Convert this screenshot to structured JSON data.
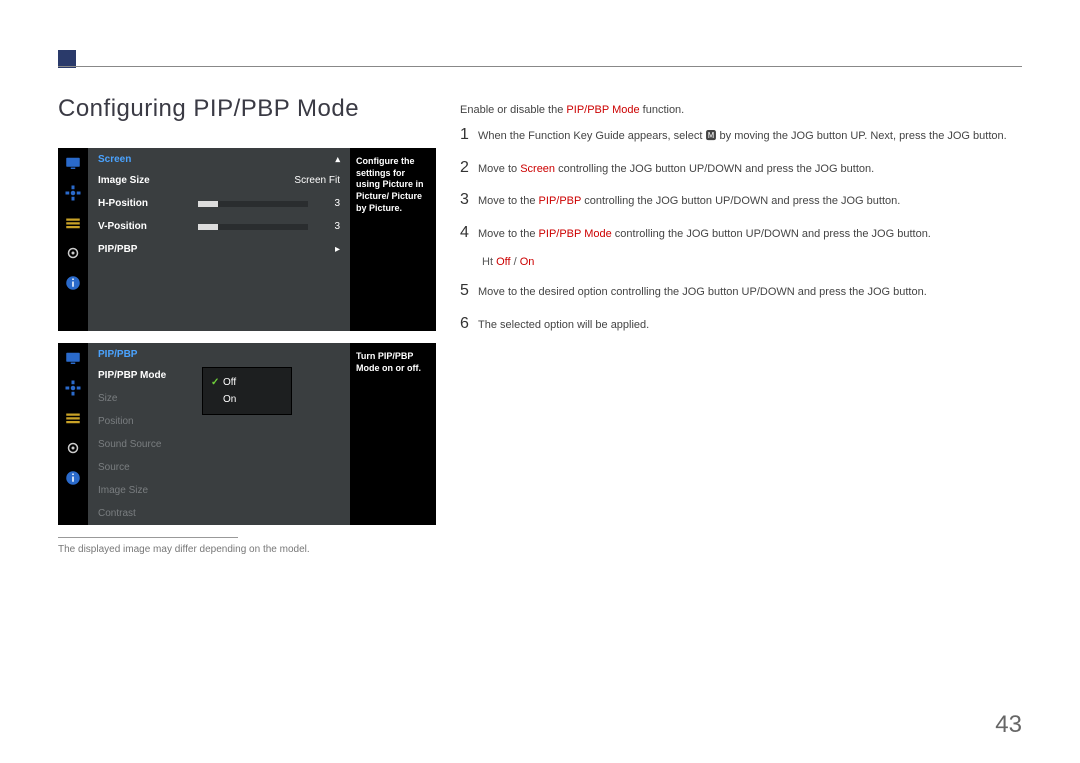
{
  "page": {
    "title": "Configuring PIP/PBP Mode",
    "page_number": "43",
    "footnote": "The displayed image may differ depending on the model."
  },
  "osd1": {
    "header": "Screen",
    "rows": {
      "imageSize": {
        "label": "Image Size",
        "value": "Screen Fit"
      },
      "hPosition": {
        "label": "H-Position",
        "value": "3",
        "fill_pct": 18
      },
      "vPosition": {
        "label": "V-Position",
        "value": "3",
        "fill_pct": 18
      },
      "pippbp": {
        "label": "PIP/PBP",
        "arrow": "▸"
      }
    },
    "side": "Configure the settings for using Picture in Picture/ Picture by Picture."
  },
  "osd2": {
    "header": "PIP/PBP",
    "rows": {
      "mode": "PIP/PBP Mode",
      "size": "Size",
      "position": "Position",
      "sound": "Sound Source",
      "source": "Source",
      "imageSize": "Image Size",
      "contrast": "Contrast"
    },
    "popup": {
      "off": "Off",
      "on": "On"
    },
    "side": "Turn PIP/PBP Mode on or off."
  },
  "steps": {
    "intro_a": "Enable or disable the ",
    "intro_b": "PIP/PBP Mode",
    "intro_c": " function.",
    "s1": "When the Function Key Guide appears, select 🅼 by moving the JOG button UP. Next, press the JOG button.",
    "s2a": "Move to ",
    "s2b": "Screen",
    "s2c": " controlling the JOG button UP/DOWN and press the JOG button.",
    "s3a": "Move to the ",
    "s3b": "PIP/PBP",
    "s3c": " controlling the JOG button UP/DOWN and press the JOG button.",
    "s4a": "Move to the ",
    "s4b": "PIP/PBP Mode",
    "s4c": " controlling the JOG button UP/DOWN and press the JOG button.",
    "opt_a": "Ht  ",
    "opt_off": "Off",
    "opt_sep": " / ",
    "opt_on": "On",
    "s5": "Move to the desired option controlling the JOG button UP/DOWN and press the JOG button.",
    "s6": "The selected option will be applied."
  },
  "nums": {
    "n1": "1",
    "n2": "2",
    "n3": "3",
    "n4": "4",
    "n5": "5",
    "n6": "6"
  }
}
